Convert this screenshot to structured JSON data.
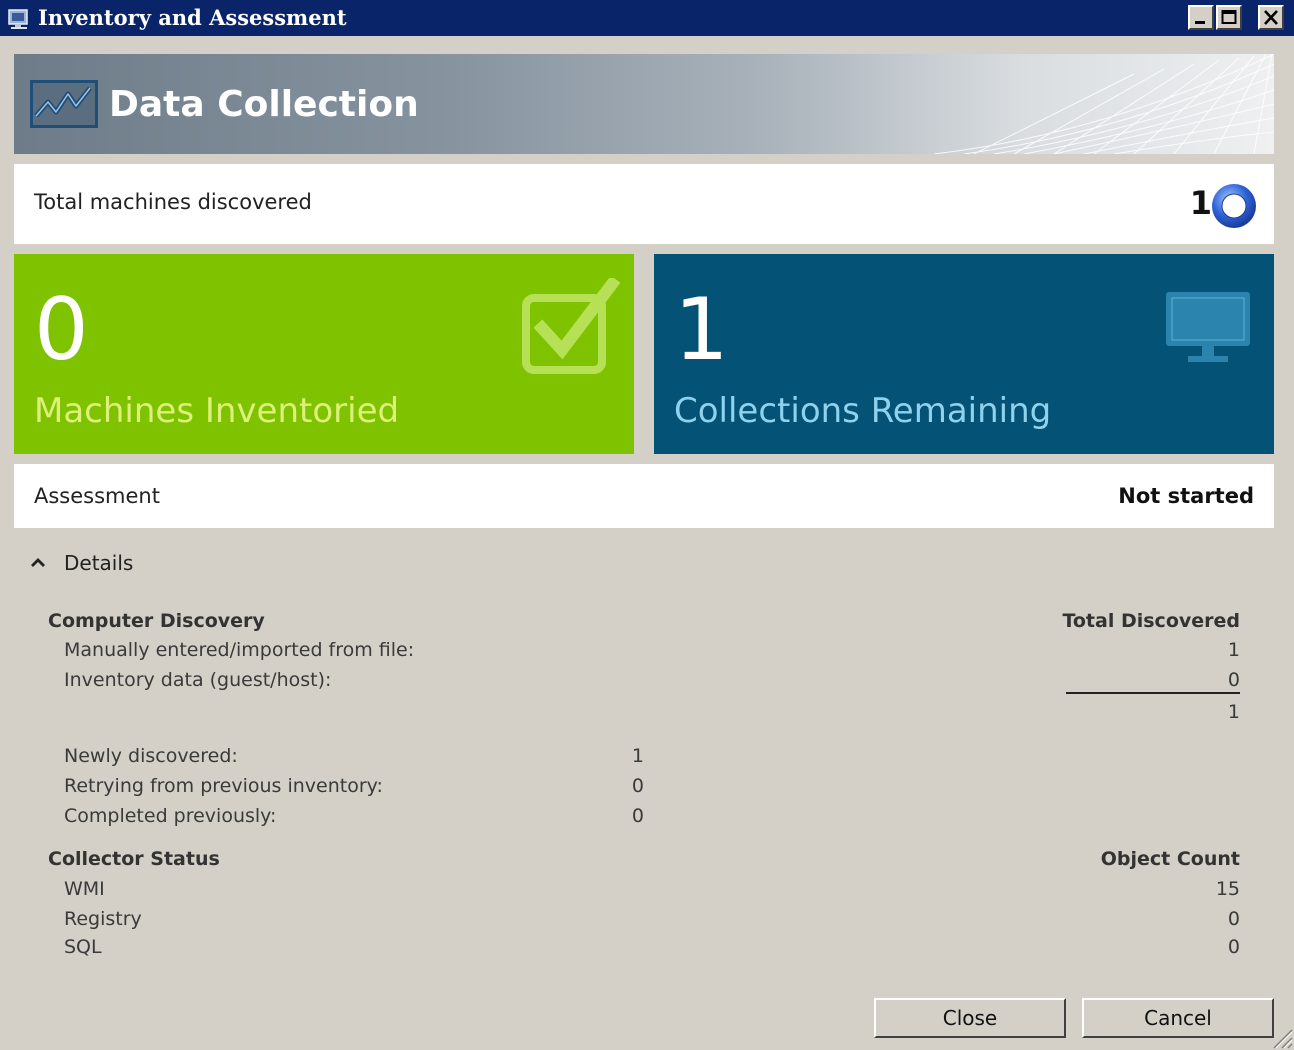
{
  "window": {
    "title": "Inventory and Assessment",
    "controls": [
      "minimize-icon",
      "maximize-icon",
      "close-icon"
    ]
  },
  "header": {
    "title": "Data Collection",
    "icon": "line-chart-icon"
  },
  "summary": {
    "total_label": "Total machines discovered",
    "total_value": "1",
    "status_icon": "progress-ring-icon"
  },
  "tiles": [
    {
      "value": "0",
      "label": "Machines Inventoried",
      "icon": "checkbox-checked-icon",
      "color": "#7fc300"
    },
    {
      "value": "1",
      "label": "Collections Remaining",
      "icon": "monitor-icon",
      "color": "#045276"
    }
  ],
  "assessment": {
    "label": "Assessment",
    "status": "Not started"
  },
  "details": {
    "toggle_label": "Details",
    "computer_discovery": {
      "heading": "Computer Discovery",
      "column_heading": "Total Discovered",
      "rows": [
        {
          "label": "Manually entered/imported from file:",
          "value": "1"
        },
        {
          "label": "Inventory data (guest/host):",
          "value": "0"
        }
      ],
      "total": "1",
      "status_rows": [
        {
          "label": "Newly discovered:",
          "value": "1"
        },
        {
          "label": "Retrying from previous inventory:",
          "value": "0"
        },
        {
          "label": "Completed previously:",
          "value": "0"
        }
      ]
    },
    "collector_status": {
      "heading": "Collector Status",
      "column_heading": "Object Count",
      "rows": [
        {
          "label": "WMI",
          "value": "15"
        },
        {
          "label": "Registry",
          "value": "0"
        },
        {
          "label": "SQL",
          "value": "0"
        }
      ]
    }
  },
  "buttons": {
    "close_label": "Close",
    "cancel_label": "Cancel"
  }
}
